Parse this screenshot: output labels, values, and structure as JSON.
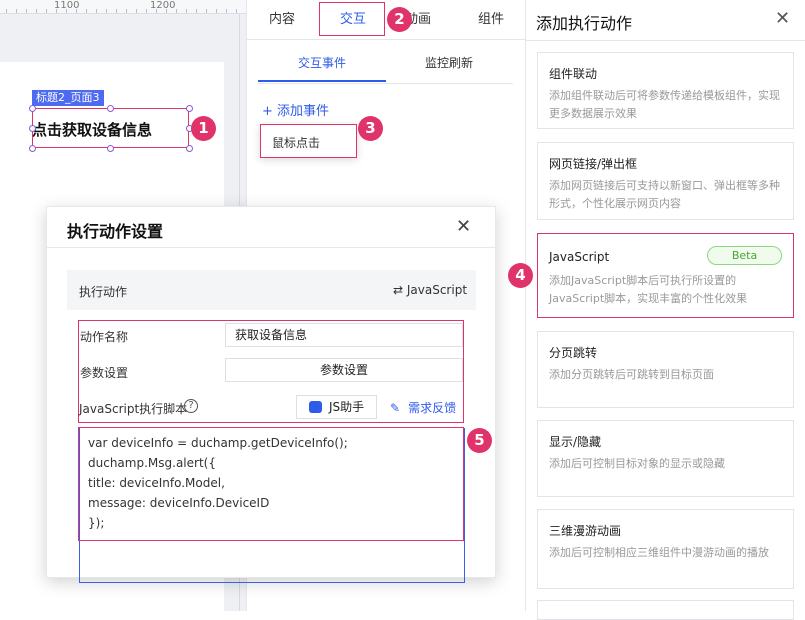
{
  "ruler": {
    "labels": [
      "1100",
      "1200"
    ]
  },
  "canvas": {
    "component_tag": "标题2_页面3",
    "component_text": "点击获取设备信息"
  },
  "badges": [
    "1",
    "2",
    "3",
    "4",
    "5"
  ],
  "mid_panel": {
    "tabs": [
      "内容",
      "交互",
      "动画",
      "组件"
    ],
    "sub_tabs": [
      "交互事件",
      "监控刷新"
    ],
    "add_event": "+ 添加事件",
    "event_option": "鼠标点击"
  },
  "right_panel": {
    "title": "添加执行动作",
    "close": "✕",
    "cards": [
      {
        "title": "组件联动",
        "desc": "添加组件联动后可将参数传递给模板组件，实现更多数据展示效果"
      },
      {
        "title": "网页链接/弹出框",
        "desc": "添加网页链接后可支持以新窗口、弹出框等多种形式，个性化展示网页内容"
      },
      {
        "title": "JavaScript",
        "desc": "添加JavaScript脚本后可执行所设置的JavaScript脚本，实现丰富的个性化效果",
        "badge": "Beta"
      },
      {
        "title": "分页跳转",
        "desc": "添加分页跳转后可跳转到目标页面"
      },
      {
        "title": "显示/隐藏",
        "desc": "添加后可控制目标对象的显示或隐藏"
      },
      {
        "title": "三维漫游动画",
        "desc": "添加后可控制相应三维组件中漫游动画的播放"
      }
    ]
  },
  "dialog": {
    "title": "执行动作设置",
    "close": "✕",
    "action_label": "执行动作",
    "action_value": "⇄ JavaScript",
    "name_label": "动作名称",
    "name_value": "获取设备信息",
    "param_label": "参数设置",
    "param_button": "参数设置",
    "script_label": "JavaScript执行脚本",
    "help_icon": "?",
    "js_helper": "JS助手",
    "feedback": "需求反馈",
    "code": [
      "var deviceInfo = duchamp.getDeviceInfo();",
      "duchamp.Msg.alert({",
      "title: deviceInfo.Model,",
      "message: deviceInfo.DeviceID",
      "});"
    ]
  },
  "colors": {
    "accent": "#2f5bea",
    "highlight": "#e0336a",
    "beta": "#4ba534"
  }
}
